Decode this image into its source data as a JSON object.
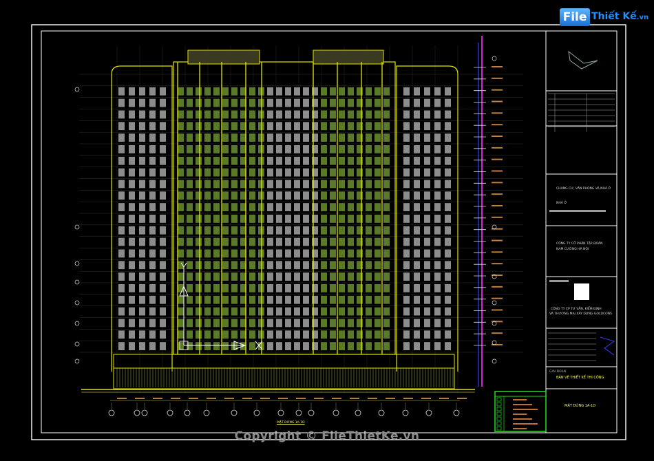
{
  "watermark": {
    "logo_file": "File",
    "logo_rest": "Thiết Kế",
    "logo_tld": ".vn",
    "copyright": "Copyright © FileThietKe.vn"
  },
  "title_block": {
    "project_line": "CHUNG CƯ, VĂN PHÒNG VÀ NHÀ Ở",
    "item_line": "NHÀ Ở",
    "owner_line_1": "CÔNG TY CỔ PHẦN TẬP ĐOÀN",
    "owner_line_2": "NAM CƯỜNG HÀ NỘI",
    "consultant_line_1": "CÔNG TY CP TƯ VẤN, KIỂM ĐỊNH",
    "consultant_line_2": "VÀ THƯƠNG MẠI XÂY DỰNG GOLDCONS",
    "stage_label": "GIAI ĐOẠN",
    "stage_value": "BẢN VẼ THIẾT KẾ THI CÔNG",
    "drawing_name": "MẶT ĐỨNG 1A-1D",
    "revision_rows": [
      "1",
      "2",
      "3",
      "4",
      "5"
    ]
  },
  "drawing": {
    "view_title": "MẶT ĐỨNG 1A-1D",
    "floors": 24,
    "grid_bubbles": 17,
    "colors": {
      "background": "#000000",
      "border": "#ffffff",
      "facade_yellow": "#e6e600",
      "window_gray": "#8c8c8c",
      "window_green": "#5a7a2a",
      "axis_white": "#ffffff",
      "section_magenta": "#d020d0",
      "section_blue": "#3040ff",
      "table_green": "#20e020",
      "level_red": "#d04040"
    }
  }
}
